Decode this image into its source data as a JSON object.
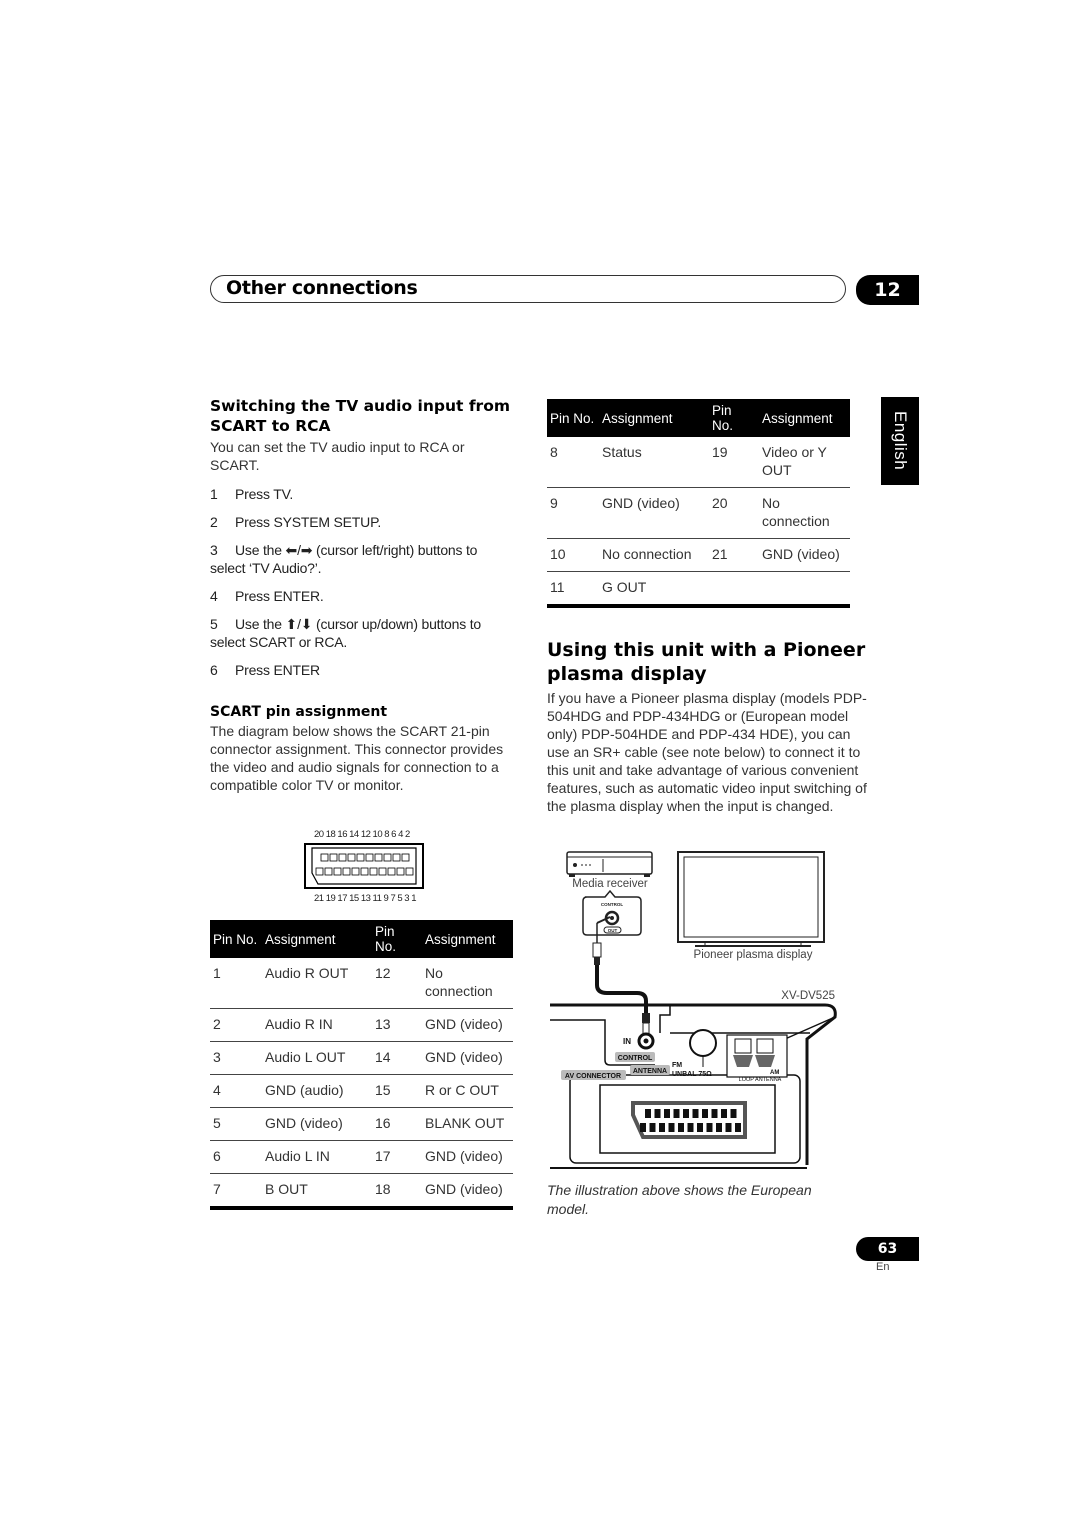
{
  "header": {
    "title": "Other connections",
    "chapter": "12"
  },
  "language_tab": "English",
  "switching": {
    "heading": "Switching the TV audio input from SCART to RCA",
    "intro": "You can set the TV audio input to RCA or SCART.",
    "steps": [
      {
        "n": "1",
        "text": "Press TV."
      },
      {
        "n": "2",
        "text": "Press SYSTEM SETUP."
      },
      {
        "n": "3",
        "text": "Use the ⬅/➡ (cursor left/right) buttons to select ‘TV Audio?’."
      },
      {
        "n": "4",
        "text": "Press ENTER."
      },
      {
        "n": "5",
        "text": "Use the ⬆/⬇ (cursor up/down) buttons to select SCART or RCA."
      },
      {
        "n": "6",
        "text": "Press ENTER"
      }
    ]
  },
  "scart": {
    "heading": "SCART pin assignment",
    "description": "The diagram below shows the SCART 21-pin connector assignment. This connector provides the video and audio signals for connection to a compatible color TV or monitor.",
    "top_pins": "20 18 16 14 12 10 8 6 4 2",
    "bottom_pins": "21 19 17 15 13 11 9 7 5 3 1",
    "table_headers": [
      "Pin No.",
      "Assignment",
      "Pin No.",
      "Assignment"
    ],
    "table1": [
      [
        "1",
        "Audio R OUT",
        "12",
        "No connection"
      ],
      [
        "2",
        "Audio R IN",
        "13",
        "GND (video)"
      ],
      [
        "3",
        "Audio L OUT",
        "14",
        "GND (video)"
      ],
      [
        "4",
        "GND (audio)",
        "15",
        "R or C OUT"
      ],
      [
        "5",
        "GND (video)",
        "16",
        "BLANK OUT"
      ],
      [
        "6",
        "Audio L IN",
        "17",
        "GND (video)"
      ],
      [
        "7",
        "B OUT",
        "18",
        "GND (video)"
      ]
    ],
    "table2": [
      [
        "8",
        "Status",
        "19",
        "Video or Y OUT"
      ],
      [
        "9",
        "GND (video)",
        "20",
        "No connection"
      ],
      [
        "10",
        "No connection",
        "21",
        "GND (video)"
      ],
      [
        "11",
        "G OUT",
        "",
        ""
      ]
    ]
  },
  "plasma": {
    "heading": "Using this unit with a Pioneer plasma display",
    "body": "If you have a Pioneer plasma display (models PDP-504HDG and PDP-434HDG or (European model only)  PDP-504HDE and PDP-434 HDE), you can use an SR+ cable (see note below) to connect it to this unit and take advantage of various convenient features, such as automatic video input switching of the plasma display when the input is changed.",
    "illustration": {
      "media_receiver": "Media receiver",
      "plasma_display": "Pioneer plasma display",
      "model": "XV-DV525",
      "control_small": "CONTROL",
      "out_small": "OUT",
      "in_label": "IN",
      "control_label": "CONTROL",
      "av_connector": "AV CONNECTOR",
      "antenna": "ANTENNA",
      "fm": "FM",
      "unbal": "UNBAL 75Ω",
      "am": "AM",
      "loop_antenna": "LOOP ANTENNA"
    },
    "caption": "The illustration above shows the European model."
  },
  "footer": {
    "page": "63",
    "lang": "En"
  }
}
